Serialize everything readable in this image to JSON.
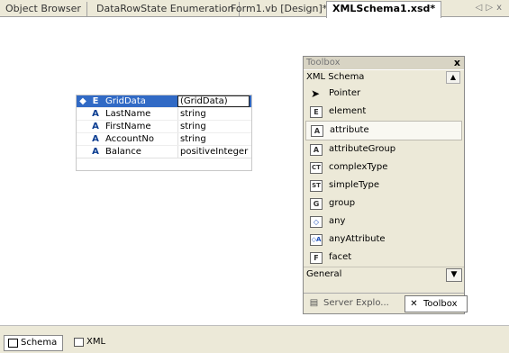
{
  "tabs": [
    {
      "label": "Object Browser"
    },
    {
      "label": "DataRowState Enumeration"
    },
    {
      "label": "Form1.vb [Design]*"
    },
    {
      "label": "XMLSchema1.xsd*"
    }
  ],
  "nav": {
    "prev": "◁",
    "next": "▷",
    "close": "x"
  },
  "schema": {
    "header": {
      "icon": "◆",
      "type": "E",
      "name": "GridData",
      "dtype": "(GridData)"
    },
    "rows": [
      {
        "type": "A",
        "name": "LastName",
        "dtype": "string"
      },
      {
        "type": "A",
        "name": "FirstName",
        "dtype": "string"
      },
      {
        "type": "A",
        "name": "AccountNo",
        "dtype": "string"
      },
      {
        "type": "A",
        "name": "Balance",
        "dtype": "positiveInteger"
      }
    ]
  },
  "toolbox": {
    "title": "Toolbox",
    "close": "x",
    "section": "XML Schema",
    "items": [
      {
        "label": "Pointer",
        "icon": "pointer-icon",
        "glyph": "▲"
      },
      {
        "label": "element",
        "icon": "element-icon",
        "glyph": "E"
      },
      {
        "label": "attribute",
        "icon": "attribute-icon",
        "glyph": "A"
      },
      {
        "label": "attributeGroup",
        "icon": "attribute-group-icon",
        "glyph": "A"
      },
      {
        "label": "complexType",
        "icon": "complex-type-icon",
        "glyph": "CT"
      },
      {
        "label": "simpleType",
        "icon": "simple-type-icon",
        "glyph": "ST"
      },
      {
        "label": "group",
        "icon": "group-icon",
        "glyph": "G"
      },
      {
        "label": "any",
        "icon": "any-icon",
        "glyph": "◇"
      },
      {
        "label": "anyAttribute",
        "icon": "any-attribute-icon",
        "glyph": "◇A"
      },
      {
        "label": "facet",
        "icon": "facet-icon",
        "glyph": "F"
      }
    ],
    "general": "General",
    "bottom_tabs": [
      {
        "label": "Server Explo...",
        "icon": "server-explorer-icon"
      },
      {
        "label": "Toolbox",
        "icon": "toolbox-icon"
      }
    ]
  },
  "bottom_tabs": [
    {
      "label": "Schema"
    },
    {
      "label": "XML"
    }
  ],
  "colors": {
    "selection": "#316ac5",
    "background": "#ece9d8",
    "canvas": "#ffffff"
  }
}
